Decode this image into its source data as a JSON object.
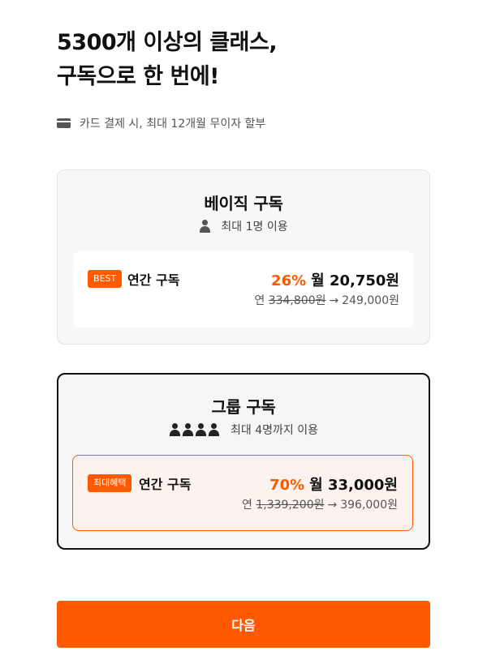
{
  "headline": {
    "line1": "5300개 이상의 클래스,",
    "line2": "구독으로 한 번에!"
  },
  "payment_note": {
    "icon": "credit-card-icon",
    "text": "카드 결제 시, 최대 12개월 무이자 할부"
  },
  "plans": [
    {
      "title": "베이직 구독",
      "users_icon": "person-icon",
      "users_text": "최대 1명 이용",
      "option": {
        "badge": "BEST",
        "name": "연간 구독",
        "discount": "26%",
        "monthly_price": "월 20,750원",
        "year_prefix": "연",
        "original_price": "334,800원",
        "arrow": "→",
        "final_price": "249,000원"
      }
    },
    {
      "title": "그룹 구독",
      "users_icon": "group-icon",
      "users_text": "최대 4명까지 이용",
      "option": {
        "badge": "최대혜택",
        "name": "연간 구독",
        "discount": "70%",
        "monthly_price": "월 33,000원",
        "year_prefix": "연",
        "original_price": "1,339,200원",
        "arrow": "→",
        "final_price": "396,000원"
      }
    }
  ],
  "next_button": "다음",
  "colors": {
    "accent": "#ff5a00",
    "selected_border": "#111111"
  }
}
